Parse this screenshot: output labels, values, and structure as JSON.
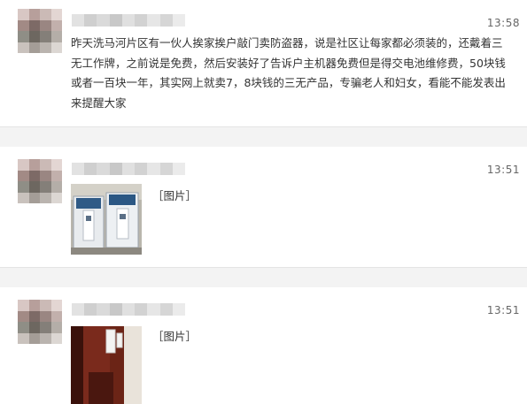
{
  "messages": [
    {
      "time": "13:58",
      "text": "昨天洗马河片区有一伙人挨家挨户敲门卖防盗器，说是社区让每家都必须装的，还戴着三无工作牌，之前说是免费，然后安装好了告诉户主机器免费但是得交电池维修费，50块钱或者一百块一年，其实网上就卖7，8块钱的三无产品，专骗老人和妇女，看能不能发表出来提醒大家"
    },
    {
      "time": "13:51",
      "image_label": "［图片］"
    },
    {
      "time": "13:51",
      "image_label": "［图片］"
    }
  ]
}
